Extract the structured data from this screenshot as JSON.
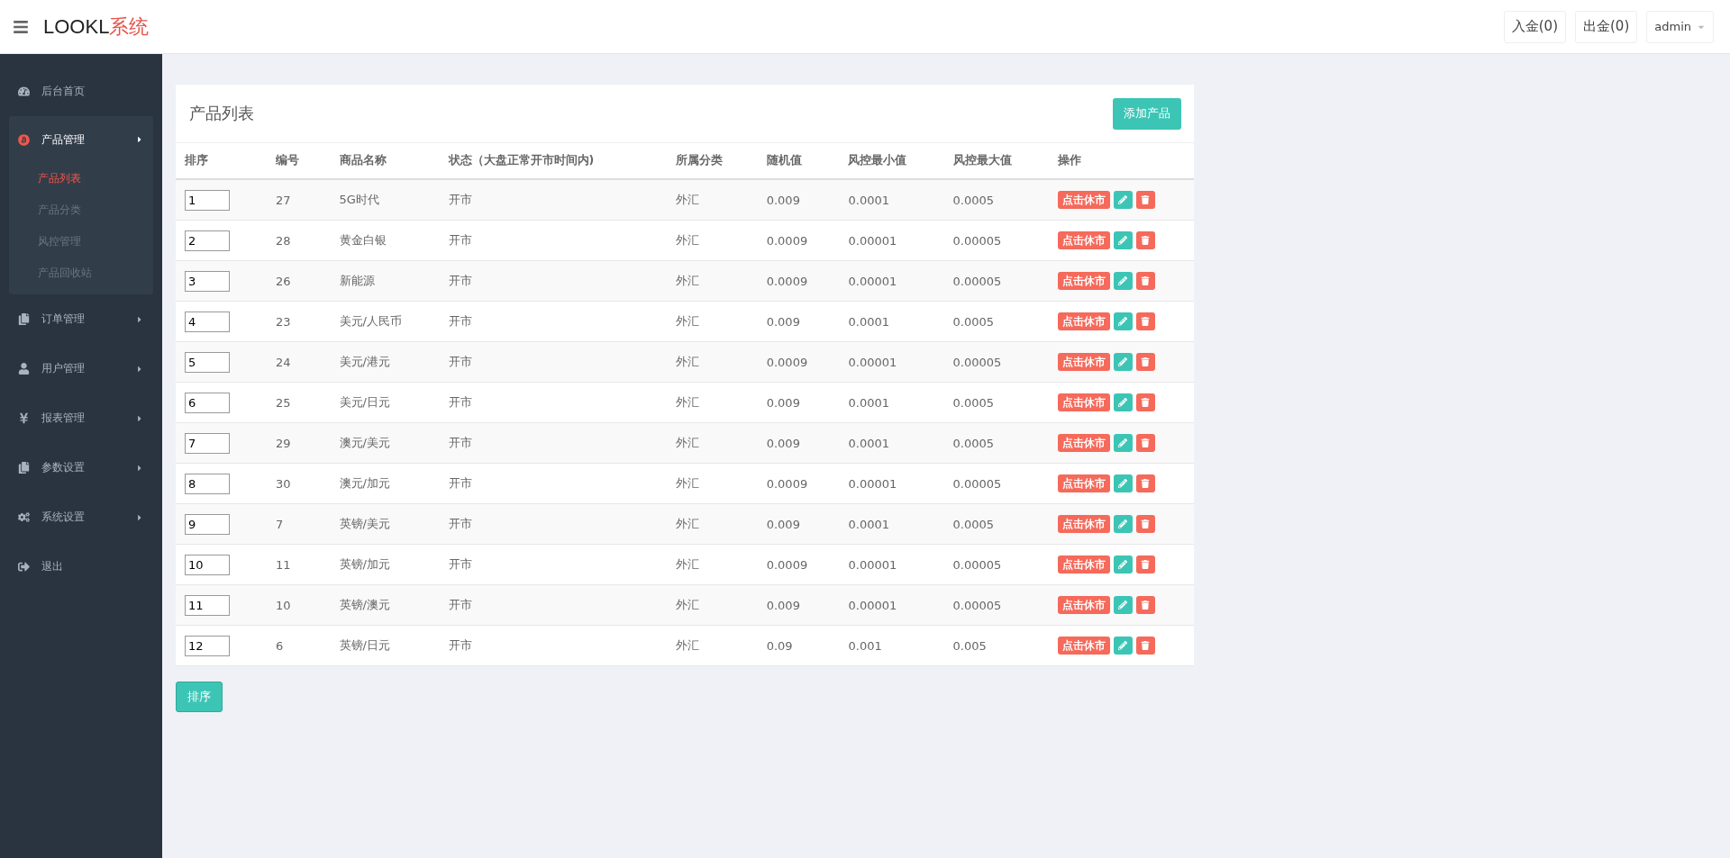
{
  "header": {
    "logo_main": "LOOKL",
    "logo_accent": "系统",
    "actions": [
      "入金(0)",
      "出金(0)"
    ],
    "user": "admin"
  },
  "sidebar": {
    "items": [
      {
        "kind": "link",
        "label": "后台首页",
        "selected": false
      },
      {
        "kind": "menu",
        "label": "产品管理",
        "expanded": true,
        "selected": true,
        "children": [
          {
            "label": "产品列表",
            "selected": true
          },
          {
            "label": "产品分类",
            "selected": false
          },
          {
            "label": "风控管理",
            "selected": false
          },
          {
            "label": "产品回收站",
            "selected": false
          }
        ]
      },
      {
        "kind": "menu",
        "label": "订单管理",
        "expanded": false,
        "selected": false
      },
      {
        "kind": "menu",
        "label": "用户管理",
        "expanded": false,
        "selected": false
      },
      {
        "kind": "menu",
        "label": "报表管理",
        "expanded": false,
        "selected": false
      },
      {
        "kind": "menu",
        "label": "参数设置",
        "expanded": false,
        "selected": false
      },
      {
        "kind": "menu",
        "label": "系统设置",
        "expanded": false,
        "selected": false
      },
      {
        "kind": "link",
        "label": "退出",
        "selected": false
      }
    ]
  },
  "card": {
    "title": "产品列表",
    "add_button": "添加产品"
  },
  "table": {
    "columns": [
      "排序",
      "编号",
      "商品名称",
      "状态（大盘正常开市时间内)",
      "所属分类",
      "随机值",
      "风控最小值",
      "风控最大值",
      "操作"
    ],
    "rows": [
      {
        "order": "1",
        "id": "27",
        "name": "5G时代",
        "status": "开市",
        "category": "外汇",
        "random": "0.009",
        "min": "0.0001",
        "max": "0.0005",
        "action": "点击休市"
      },
      {
        "order": "2",
        "id": "28",
        "name": "黄金白银",
        "status": "开市",
        "category": "外汇",
        "random": "0.0009",
        "min": "0.00001",
        "max": "0.00005",
        "action": "点击休市"
      },
      {
        "order": "3",
        "id": "26",
        "name": "新能源",
        "status": "开市",
        "category": "外汇",
        "random": "0.0009",
        "min": "0.00001",
        "max": "0.00005",
        "action": "点击休市"
      },
      {
        "order": "4",
        "id": "23",
        "name": "美元/人民币",
        "status": "开市",
        "category": "外汇",
        "random": "0.009",
        "min": "0.0001",
        "max": "0.0005",
        "action": "点击休市"
      },
      {
        "order": "5",
        "id": "24",
        "name": "美元/港元",
        "status": "开市",
        "category": "外汇",
        "random": "0.0009",
        "min": "0.00001",
        "max": "0.00005",
        "action": "点击休市"
      },
      {
        "order": "6",
        "id": "25",
        "name": "美元/日元",
        "status": "开市",
        "category": "外汇",
        "random": "0.009",
        "min": "0.0001",
        "max": "0.0005",
        "action": "点击休市"
      },
      {
        "order": "7",
        "id": "29",
        "name": "澳元/美元",
        "status": "开市",
        "category": "外汇",
        "random": "0.009",
        "min": "0.0001",
        "max": "0.0005",
        "action": "点击休市"
      },
      {
        "order": "8",
        "id": "30",
        "name": "澳元/加元",
        "status": "开市",
        "category": "外汇",
        "random": "0.0009",
        "min": "0.00001",
        "max": "0.00005",
        "action": "点击休市"
      },
      {
        "order": "9",
        "id": "7",
        "name": "英镑/美元",
        "status": "开市",
        "category": "外汇",
        "random": "0.009",
        "min": "0.0001",
        "max": "0.0005",
        "action": "点击休市"
      },
      {
        "order": "10",
        "id": "11",
        "name": "英镑/加元",
        "status": "开市",
        "category": "外汇",
        "random": "0.0009",
        "min": "0.00001",
        "max": "0.00005",
        "action": "点击休市"
      },
      {
        "order": "11",
        "id": "10",
        "name": "英镑/澳元",
        "status": "开市",
        "category": "外汇",
        "random": "0.009",
        "min": "0.00001",
        "max": "0.00005",
        "action": "点击休市"
      },
      {
        "order": "12",
        "id": "6",
        "name": "英镑/日元",
        "status": "开市",
        "category": "外汇",
        "random": "0.09",
        "min": "0.001",
        "max": "0.005",
        "action": "点击休市"
      }
    ]
  },
  "sort_button": "排序"
}
